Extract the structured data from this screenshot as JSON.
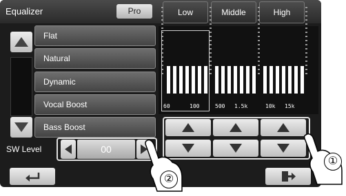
{
  "header": {
    "title": "Equalizer",
    "pro_label": "Pro",
    "tabs": [
      {
        "label": "Low"
      },
      {
        "label": "Middle"
      },
      {
        "label": "High"
      }
    ]
  },
  "presets": [
    {
      "label": "Flat"
    },
    {
      "label": "Natural"
    },
    {
      "label": "Dynamic"
    },
    {
      "label": "Vocal Boost"
    },
    {
      "label": "Bass Boost"
    }
  ],
  "sw_level": {
    "label": "SW Level",
    "value": "00"
  },
  "graph": {
    "freq_labels": [
      "60",
      "100",
      "500",
      "1.5k",
      "10k",
      "15k"
    ]
  },
  "callouts": {
    "adjust": "①",
    "sw": "②"
  },
  "icons": {
    "up": "triangle-up-icon",
    "down": "triangle-down-icon",
    "left": "triangle-left-icon",
    "right": "triangle-right-icon",
    "back": "return-arrow-icon",
    "exit": "exit-icon"
  },
  "colors": {
    "screen_bg": "#1c1c1c",
    "button_light": "#d9d9d9",
    "icon_dark": "#333333"
  }
}
